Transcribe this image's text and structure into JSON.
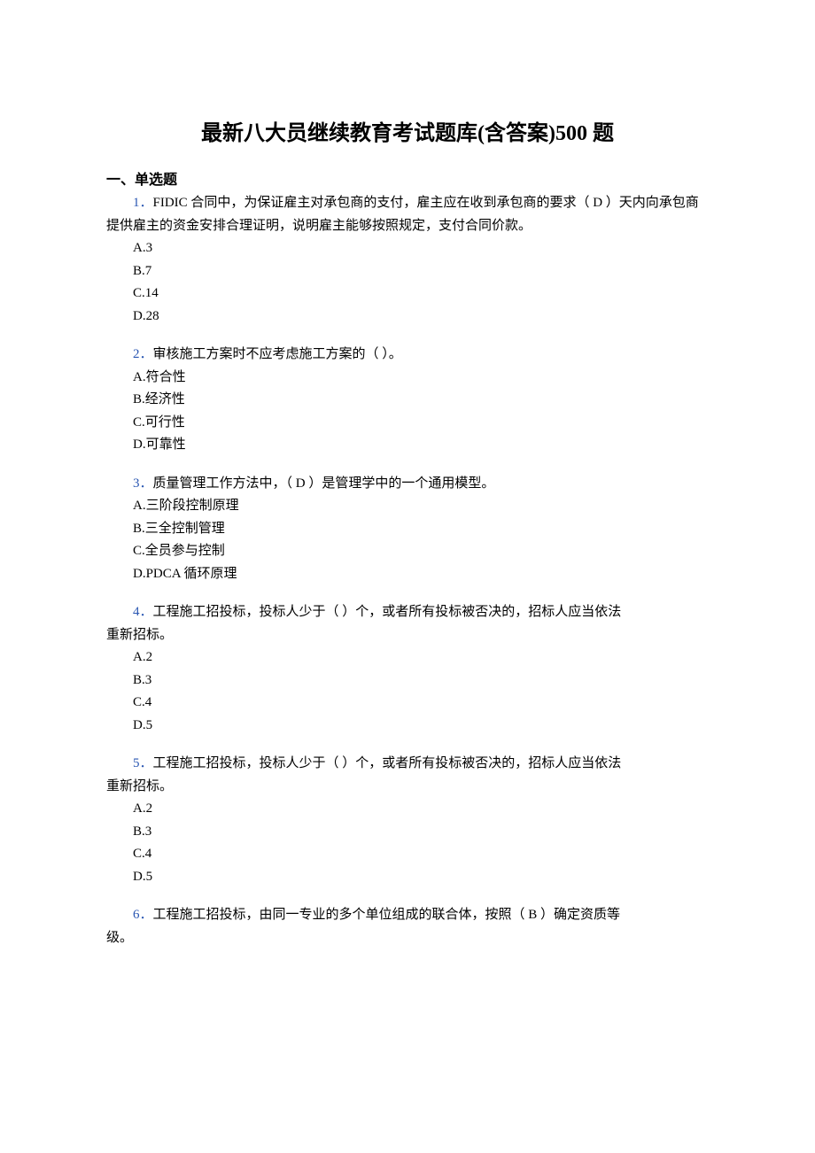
{
  "title": "最新八大员继续教育考试题库(含答案)500 题",
  "section_header": "一、单选题",
  "questions": [
    {
      "num": "1．",
      "text": "FIDIC 合同中，为保证雇主对承包商的支付，雇主应在收到承包商的要求（ D ）天内向承包商提供雇主的资金安排合理证明，说明雇主能够按照规定，支付合同价款。",
      "cont": "",
      "options": [
        "A.3",
        "B.7",
        "C.14",
        "D.28"
      ]
    },
    {
      "num": "2．",
      "text": "审核施工方案时不应考虑施工方案的（ ）。",
      "cont": "",
      "options": [
        "A.符合性",
        "B.经济性",
        "C.可行性",
        "D.可靠性"
      ]
    },
    {
      "num": "3．",
      "text": "质量管理工作方法中，（ D ）是管理学中的一个通用模型。",
      "cont": "",
      "options": [
        "A.三阶段控制原理",
        "B.三全控制管理",
        "C.全员参与控制",
        "D.PDCA 循环原理"
      ]
    },
    {
      "num": "4．",
      "text": "工程施工招投标，投标人少于（ ）个，或者所有投标被否决的，招标人应当依法",
      "cont": "重新招标。",
      "options": [
        "A.2",
        "B.3",
        "C.4",
        "D.5"
      ]
    },
    {
      "num": "5．",
      "text": "工程施工招投标，投标人少于（ ）个，或者所有投标被否决的，招标人应当依法",
      "cont": "重新招标。",
      "options": [
        "A.2",
        "B.3",
        "C.4",
        "D.5"
      ]
    },
    {
      "num": "6．",
      "text": "工程施工招投标，由同一专业的多个单位组成的联合体，按照（ B ）确定资质等",
      "cont": "级。",
      "options": []
    }
  ]
}
